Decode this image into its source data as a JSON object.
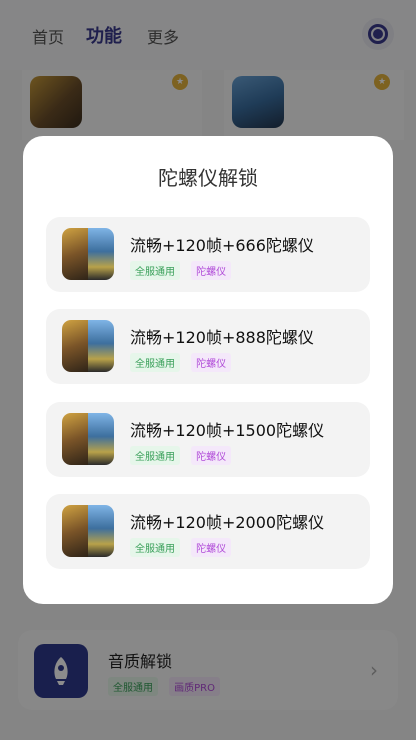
{
  "nav": {
    "tabs": [
      {
        "label": "首页"
      },
      {
        "label": "功能"
      },
      {
        "label": "更多"
      }
    ]
  },
  "colors": {
    "accent": "#3a3a8c",
    "overlay": "rgba(0,0,0,0.45)",
    "tag_green": "#3aa05a",
    "tag_purple": "#b04ad8"
  },
  "bottom_item": {
    "title": "音质解锁",
    "tags": [
      "全服通用",
      "画质PRO"
    ]
  },
  "dialog": {
    "title": "陀螺仪解锁",
    "options": [
      {
        "title": "流畅+120帧+666陀螺仪",
        "tags": [
          "全服通用",
          "陀螺仪"
        ]
      },
      {
        "title": "流畅+120帧+888陀螺仪",
        "tags": [
          "全服通用",
          "陀螺仪"
        ]
      },
      {
        "title": "流畅+120帧+1500陀螺仪",
        "tags": [
          "全服通用",
          "陀螺仪"
        ]
      },
      {
        "title": "流畅+120帧+2000陀螺仪",
        "tags": [
          "全服通用",
          "陀螺仪"
        ]
      }
    ]
  }
}
